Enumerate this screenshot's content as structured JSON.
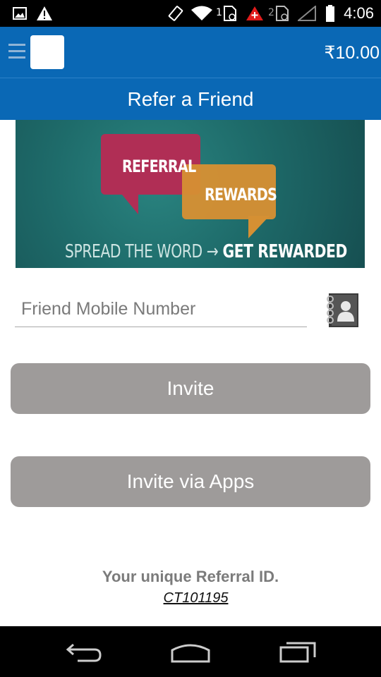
{
  "status_bar": {
    "time": "4:06",
    "icons": [
      "image-icon",
      "warning-icon",
      "rotate-icon",
      "wifi-icon",
      "sim1-icon",
      "alert-icon",
      "sim2-icon",
      "signal-icon",
      "battery-icon"
    ],
    "sim1_label": "1",
    "sim2_label": "2"
  },
  "app_bar": {
    "balance": "₹10.00"
  },
  "page": {
    "title": "Refer a Friend"
  },
  "banner": {
    "word1": "REFERRAL",
    "word2": "REWARDS",
    "tagline_left": "SPREAD THE WORD",
    "tagline_arrow": "→",
    "tagline_right": "GET REWARDED"
  },
  "form": {
    "mobile_placeholder": "Friend Mobile Number",
    "mobile_value": "",
    "invite_label": "Invite",
    "invite_apps_label": "Invite via Apps"
  },
  "referral": {
    "label": "Your unique Referral ID.",
    "id": "CT101195"
  },
  "colors": {
    "primary": "#0a68b5",
    "button": "#9e9b9a",
    "status_bar": "#000000"
  }
}
